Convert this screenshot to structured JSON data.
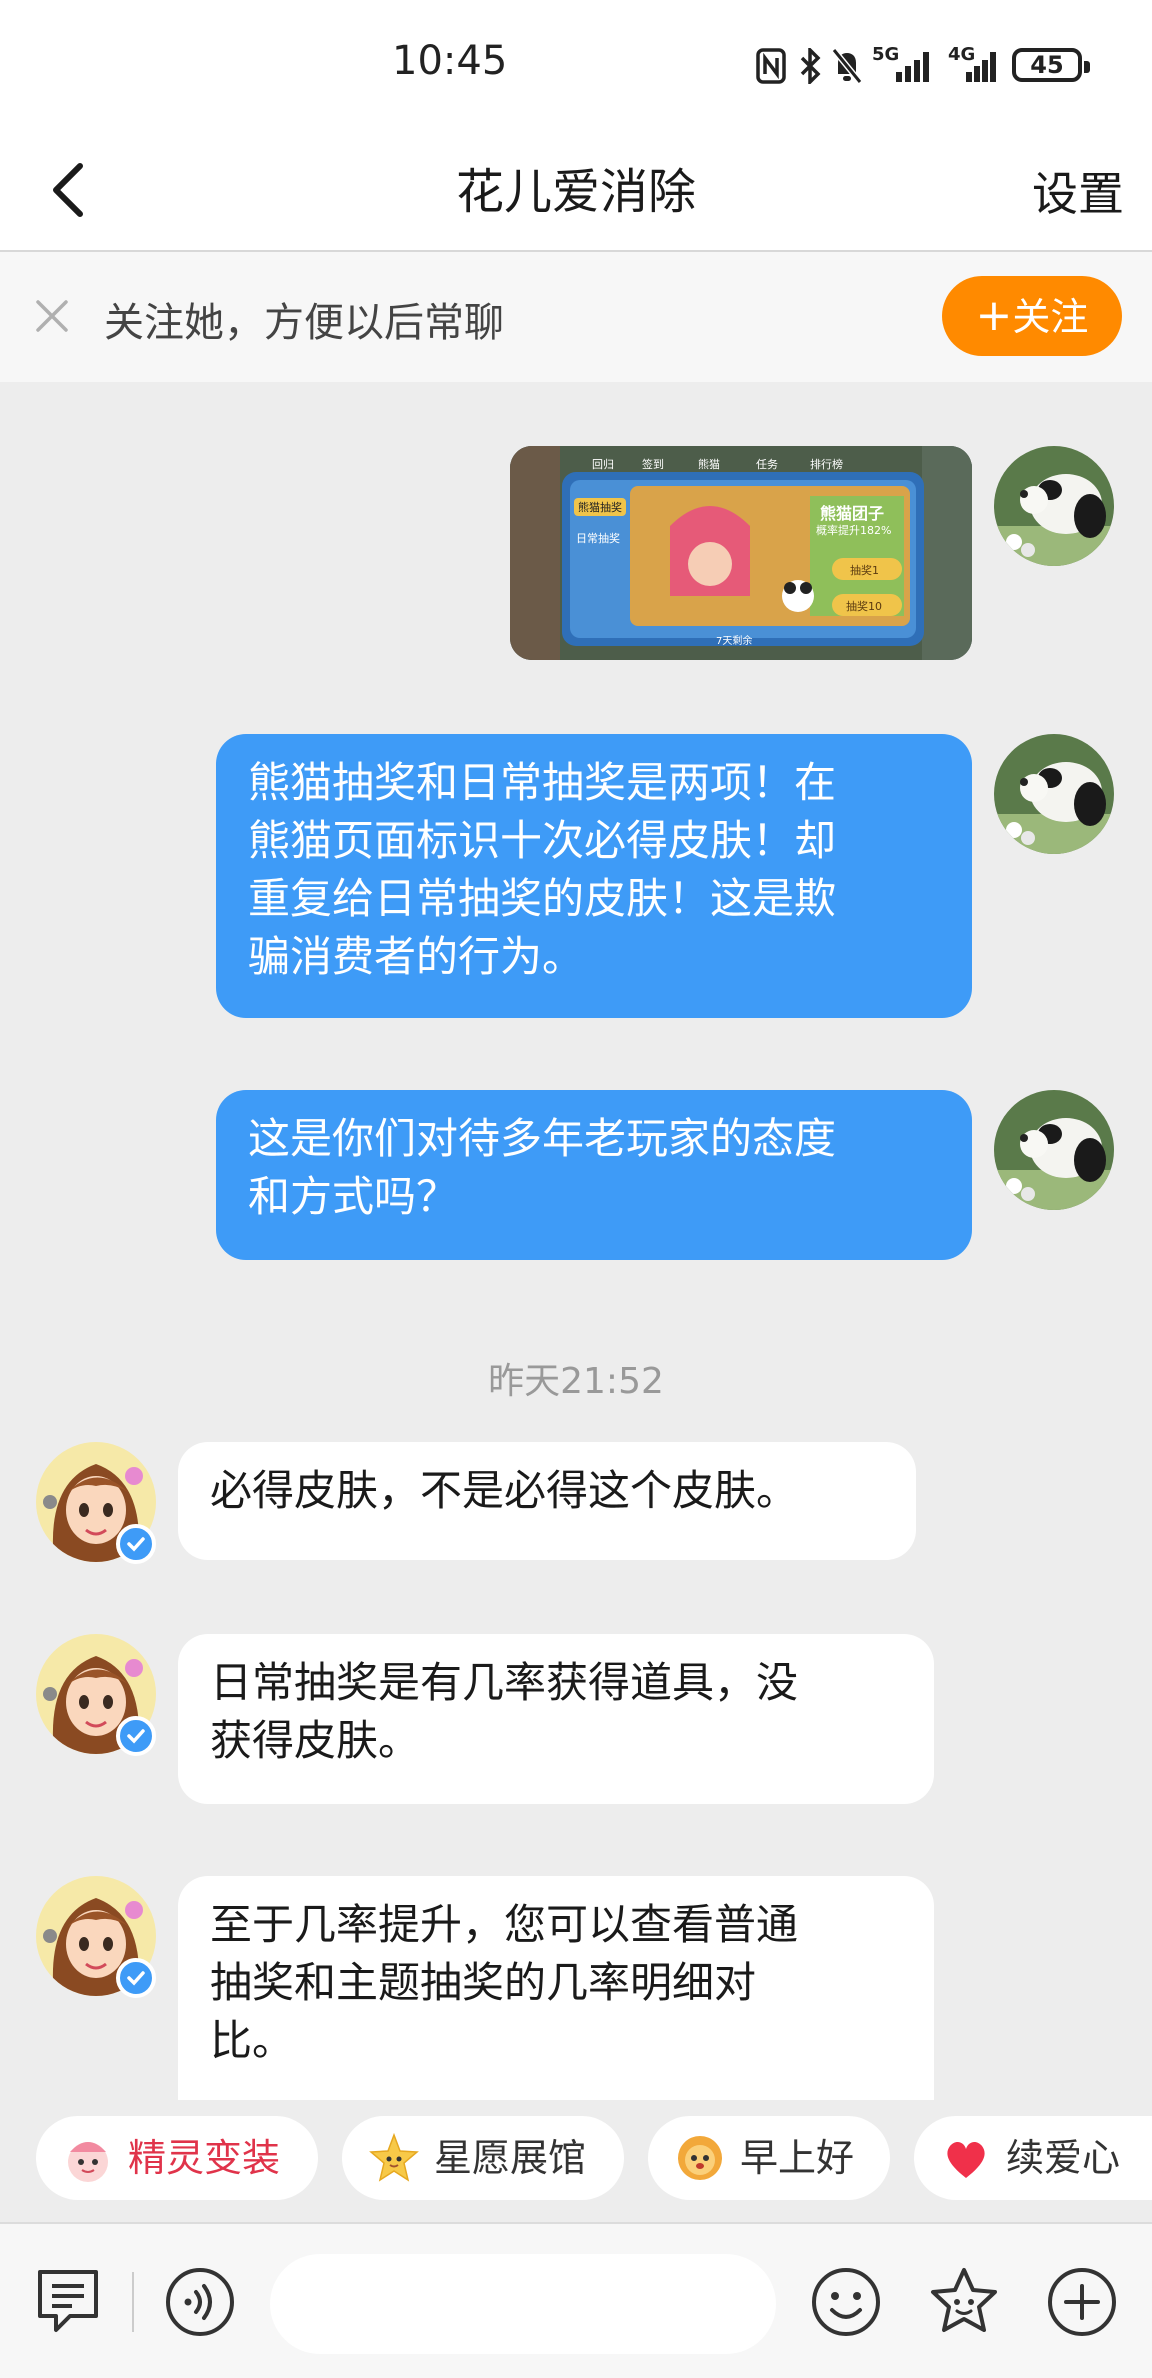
{
  "status_bar": {
    "time": "10:45",
    "network1": "5G",
    "network2": "4G",
    "battery": "45"
  },
  "header": {
    "title": "花儿爱消除",
    "settings_label": "设置"
  },
  "follow_bar": {
    "text": "关注她，方便以后常聊",
    "button_label": "关注",
    "plus": "+"
  },
  "colors": {
    "accent": "#3e9bf7",
    "follow": "#ff8a00",
    "background": "#ededed"
  },
  "shared_image": {
    "tabs": [
      "回归",
      "签到",
      "熊猫",
      "任务",
      "排行榜"
    ],
    "side_items": [
      "熊猫抽奖",
      "日常抽奖"
    ],
    "banner_title": "熊猫团子",
    "banner_sub": "概率提升182%",
    "buttons": [
      "抽奖1",
      "抽奖10"
    ],
    "footer": "7天剩余"
  },
  "messages_out": [
    {
      "text_lines": [
        "熊猫抽奖和日常抽奖是两项！在",
        "熊猫页面标识十次必得皮肤！却",
        "重复给日常抽奖的皮肤！这是欺",
        "骗消费者的行为。"
      ]
    },
    {
      "text_lines": [
        "这是你们对待多年老玩家的态度",
        "和方式吗？"
      ]
    }
  ],
  "timestamp": "昨天21:52",
  "messages_in": [
    {
      "text_lines": [
        "必得皮肤，不是必得这个皮肤。"
      ]
    },
    {
      "text_lines": [
        "日常抽奖是有几率获得道具，没",
        "获得皮肤。"
      ]
    },
    {
      "text_lines": [
        "至于几率提升，您可以查看普通",
        "抽奖和主题抽奖的几率明细对",
        "比。"
      ]
    }
  ],
  "quick_chips": [
    {
      "label": "精灵变装",
      "icon": "sprite-face-icon",
      "color": "#e0334a"
    },
    {
      "label": "星愿展馆",
      "icon": "star-face-icon",
      "color": "#333333"
    },
    {
      "label": "早上好",
      "icon": "sun-face-icon",
      "color": "#333333"
    },
    {
      "label": "续爱心",
      "icon": "heart-icon",
      "color": "#333333"
    }
  ],
  "bottom_bar": {
    "icons": [
      "text-menu-icon",
      "voice-icon",
      "emoji-icon",
      "sticker-icon",
      "add-icon"
    ],
    "input_value": ""
  }
}
